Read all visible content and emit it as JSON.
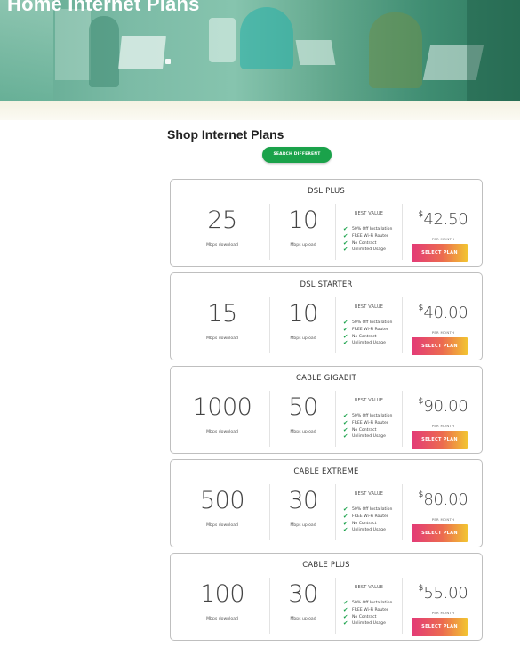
{
  "hero": {
    "title": "Home Internet Plans"
  },
  "shop": {
    "title": "Shop Internet Plans",
    "address_button": "SEARCH DIFFERENT ADDRESS"
  },
  "colors": {
    "accent_green": "#1aa24a",
    "button_pink": "#e33a78",
    "button_yellow": "#f2c531"
  },
  "plans": [
    {
      "name": "DSL PLUS",
      "download": "25",
      "download_label": "Mbps download",
      "upload": "10",
      "upload_label": "Mbps upload",
      "badge": "BEST VALUE",
      "features": [
        "50% Off Installation",
        "FREE Wi-Fi Router",
        "No Contract",
        "Unlimited Usage"
      ],
      "currency": "$",
      "price": "42.50",
      "per": "PER MONTH",
      "button": "SELECT PLAN"
    },
    {
      "name": "DSL STARTER",
      "download": "15",
      "download_label": "Mbps download",
      "upload": "10",
      "upload_label": "Mbps upload",
      "badge": "BEST VALUE",
      "features": [
        "50% Off Installation",
        "FREE Wi-Fi Router",
        "No Contract",
        "Unlimited Usage"
      ],
      "currency": "$",
      "price": "40.00",
      "per": "PER MONTH",
      "button": "SELECT PLAN"
    },
    {
      "name": "CABLE GIGABIT",
      "download": "1000",
      "download_label": "Mbps download",
      "upload": "50",
      "upload_label": "Mbps upload",
      "badge": "BEST VALUE",
      "features": [
        "50% Off Installation",
        "FREE Wi-Fi Router",
        "No Contract",
        "Unlimited Usage"
      ],
      "currency": "$",
      "price": "90.00",
      "per": "PER MONTH",
      "button": "SELECT PLAN"
    },
    {
      "name": "CABLE EXTREME",
      "download": "500",
      "download_label": "Mbps download",
      "upload": "30",
      "upload_label": "Mbps upload",
      "badge": "BEST VALUE",
      "features": [
        "50% Off Installation",
        "FREE Wi-Fi Router",
        "No Contract",
        "Unlimited Usage"
      ],
      "currency": "$",
      "price": "80.00",
      "per": "PER MONTH",
      "button": "SELECT PLAN"
    },
    {
      "name": "CABLE PLUS",
      "download": "100",
      "download_label": "Mbps download",
      "upload": "30",
      "upload_label": "Mbps upload",
      "badge": "BEST VALUE",
      "features": [
        "50% Off Installation",
        "FREE Wi-Fi Router",
        "No Contract",
        "Unlimited Usage"
      ],
      "currency": "$",
      "price": "55.00",
      "per": "PER MONTH",
      "button": "SELECT PLAN"
    }
  ]
}
